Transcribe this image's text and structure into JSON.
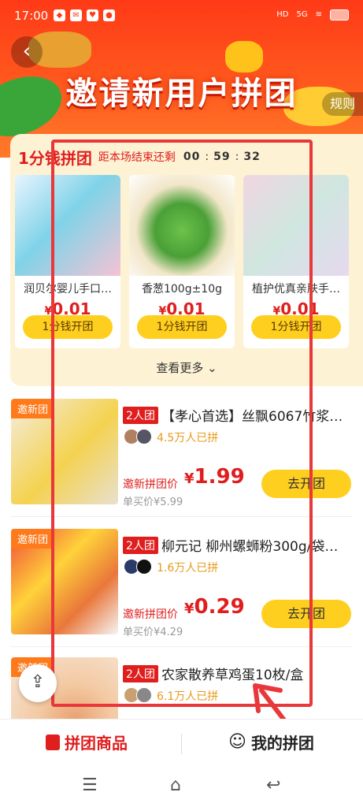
{
  "status": {
    "time": "17:00",
    "network": "5G"
  },
  "banner": {
    "title": "邀请新用户拼团",
    "rules": "规则"
  },
  "flash": {
    "title": "1分钱拼团",
    "countdown_label": "距本场结束还剩",
    "countdown": [
      "00",
      "59",
      "32"
    ],
    "products": [
      {
        "name": "润贝尔婴儿手口…",
        "price": "0.01",
        "button": "1分钱开团"
      },
      {
        "name": "香葱100g±10g",
        "price": "0.01",
        "button": "1分钱开团"
      },
      {
        "name": "植护优真亲肤手…",
        "price": "0.01",
        "button": "1分钱开团"
      }
    ],
    "more": "查看更多"
  },
  "items": [
    {
      "badge": "邀新团",
      "tag": "2人团",
      "name": "【孝心首选】丝飘6067竹浆…",
      "joined": "4.5万人已拼",
      "price_label": "邀新拼团价",
      "price": "1.99",
      "original": "单买价¥5.99",
      "button": "去开团"
    },
    {
      "badge": "邀新团",
      "tag": "2人团",
      "name": "柳元记 柳州螺蛳粉300g/袋…",
      "joined": "1.6万人已拼",
      "price_label": "邀新拼团价",
      "price": "0.29",
      "original": "单买价¥4.29",
      "button": "去开团"
    },
    {
      "badge": "邀新团",
      "tag": "2人团",
      "name": "农家散养草鸡蛋10枚/盒",
      "joined": "6.1万人已拼"
    }
  ],
  "tabs": {
    "group_goods": "拼团商品",
    "my_group": "我的拼团"
  },
  "colors": {
    "accent": "#e01e1e",
    "button": "#ffcf1f",
    "banner": "#ff3a17"
  }
}
